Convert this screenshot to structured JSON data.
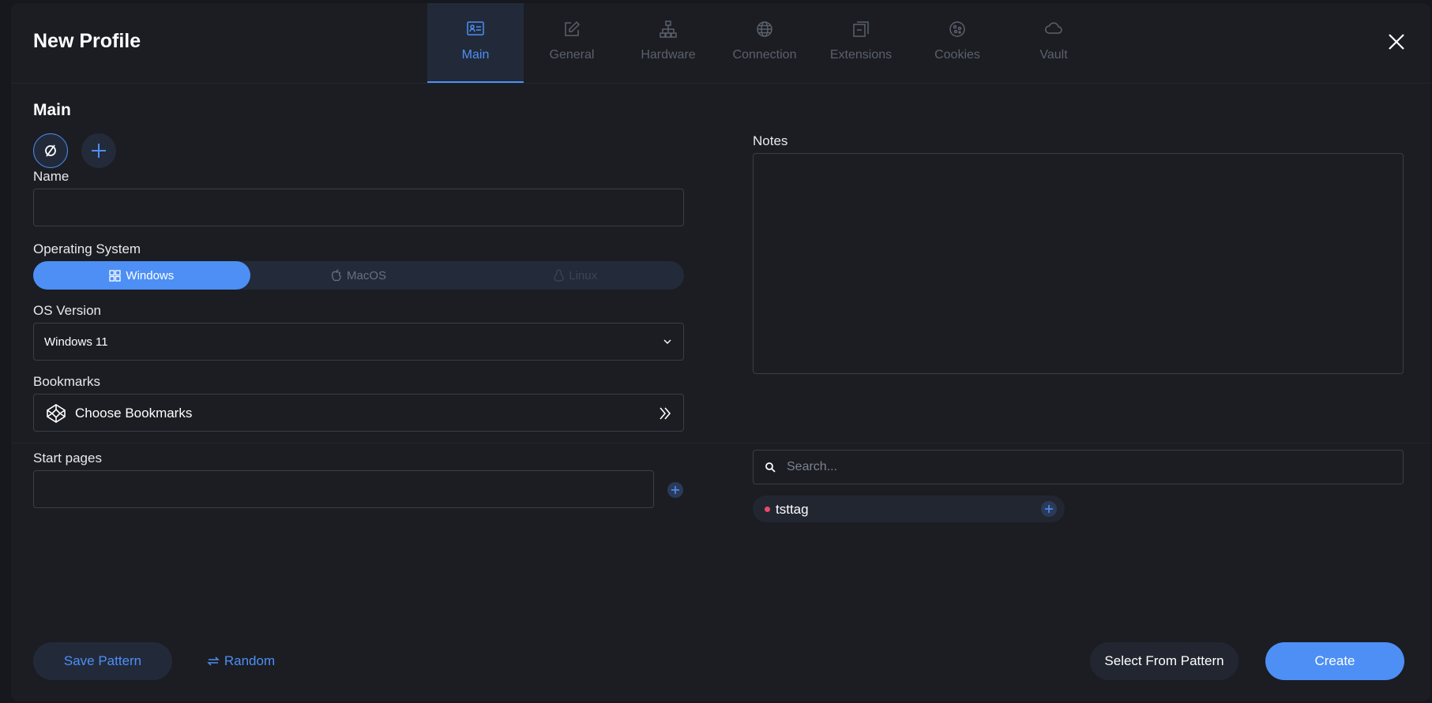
{
  "header": {
    "title": "New Profile",
    "tabs": [
      {
        "label": "Main",
        "icon": "profile-card-icon"
      },
      {
        "label": "General",
        "icon": "edit-icon"
      },
      {
        "label": "Hardware",
        "icon": "network-icon"
      },
      {
        "label": "Connection",
        "icon": "globe-icon"
      },
      {
        "label": "Extensions",
        "icon": "extensions-icon"
      },
      {
        "label": "Cookies",
        "icon": "cookie-icon"
      },
      {
        "label": "Vault",
        "icon": "cloud-icon"
      }
    ]
  },
  "main": {
    "section_title": "Main",
    "name_label": "Name",
    "name_value": "",
    "os_label": "Operating System",
    "os_options": [
      "Windows",
      "MacOS",
      "Linux"
    ],
    "os_selected": "Windows",
    "os_version_label": "OS Version",
    "os_version_value": "Windows 11",
    "bookmarks_label": "Bookmarks",
    "bookmarks_button": "Choose Bookmarks",
    "start_pages_label": "Start pages",
    "start_pages_value": ""
  },
  "side": {
    "notes_label": "Notes",
    "notes_value": "",
    "search_placeholder": "Search...",
    "tags": [
      {
        "name": "tsttag",
        "color": "#e9496b"
      }
    ]
  },
  "footer": {
    "save_pattern": "Save Pattern",
    "random": "Random",
    "select_from_pattern": "Select From Pattern",
    "create": "Create"
  },
  "colors": {
    "accent": "#4d8ff5",
    "background": "#1b1d23",
    "tag_dot": "#e9496b"
  }
}
